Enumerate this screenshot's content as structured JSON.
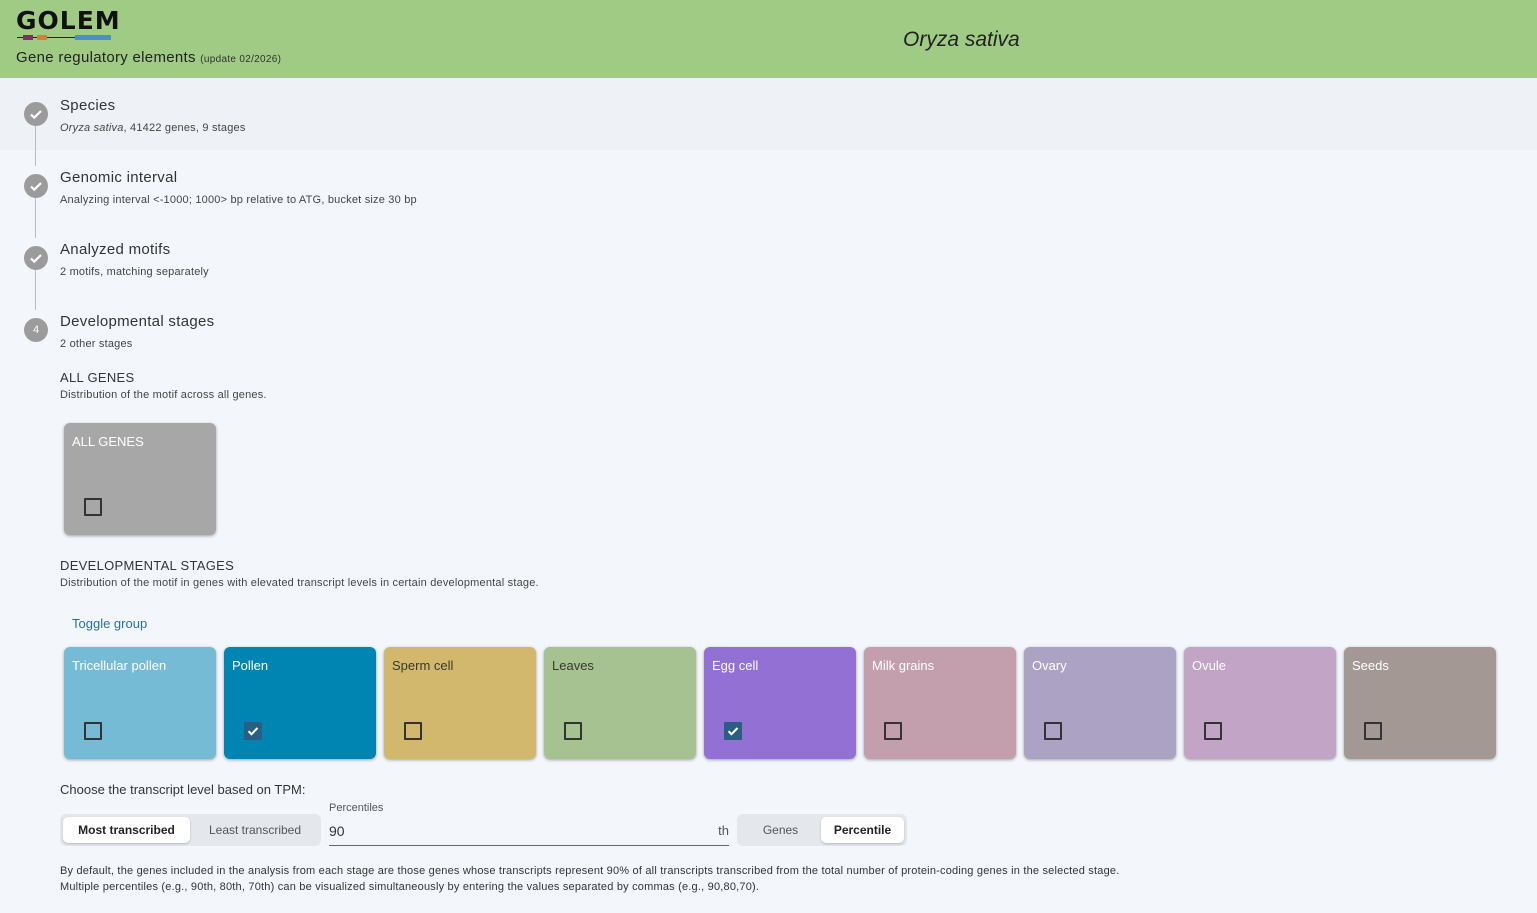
{
  "header": {
    "logo": "GOLEM",
    "subtitle": "Gene regulatory elements",
    "update": "(update 02/2026)",
    "species": "Oryza sativa"
  },
  "steps": [
    {
      "icon": "check-icon",
      "title": "Species",
      "sub_italic": "Oryza sativa",
      "sub": ", 41422 genes, 9 stages"
    },
    {
      "icon": "check-icon",
      "title": "Genomic interval",
      "sub": "Analyzing interval <-1000; 1000> bp relative to ATG, bucket size 30 bp"
    },
    {
      "icon": "check-icon",
      "title": "Analyzed motifs",
      "sub": "2 motifs, matching separately"
    },
    {
      "number": "4",
      "title": "Developmental stages",
      "sub": "2 other stages"
    }
  ],
  "all_genes": {
    "title": "ALL GENES",
    "desc": "Distribution of the motif across all genes.",
    "card": {
      "label": "ALL GENES",
      "color": "#a7a7a7",
      "checked": false
    }
  },
  "dev_stages": {
    "title": "DEVELOPMENTAL STAGES",
    "desc": "Distribution of the motif in genes with elevated transcript levels in certain developmental stage.",
    "toggle": "Toggle group",
    "cards": [
      {
        "label": "Tricellular pollen",
        "color": "#76bbd6",
        "checked": false
      },
      {
        "label": "Pollen",
        "color": "#0085b3",
        "checked": true
      },
      {
        "label": "Sperm cell",
        "color": "#d1b86d",
        "checked": false
      },
      {
        "label": "Leaves",
        "color": "#a5c290",
        "checked": false
      },
      {
        "label": "Egg cell",
        "color": "#9270d4",
        "checked": true
      },
      {
        "label": "Milk grains",
        "color": "#c39fae",
        "checked": false
      },
      {
        "label": "Ovary",
        "color": "#aca3c4",
        "checked": false
      },
      {
        "label": "Ovule",
        "color": "#c2a4c6",
        "checked": false
      },
      {
        "label": "Seeds",
        "color": "#a39893",
        "checked": false
      }
    ]
  },
  "tpm": {
    "label": "Choose the transcript level based on TPM:",
    "mode_options": [
      "Most transcribed",
      "Least transcribed"
    ],
    "mode_selected": "Most transcribed",
    "field_label": "Percentiles",
    "field_value": "90",
    "field_suffix": "th",
    "unit_options": [
      "Genes",
      "Percentile"
    ],
    "unit_selected": "Percentile"
  },
  "notes": [
    "By default, the genes included in the analysis from each stage are those genes whose transcripts represent 90% of all transcripts transcribed from the total number of protein-coding genes in the selected stage.",
    "Multiple percentiles (e.g., 90th, 80th, 70th) can be visualized simultaneously by entering the values separated by commas (e.g., 90,80,70)."
  ],
  "colors": {
    "header": "#a0cb84",
    "accent": "#2a6ea5",
    "checkbox_checked": "#2a5f82"
  }
}
